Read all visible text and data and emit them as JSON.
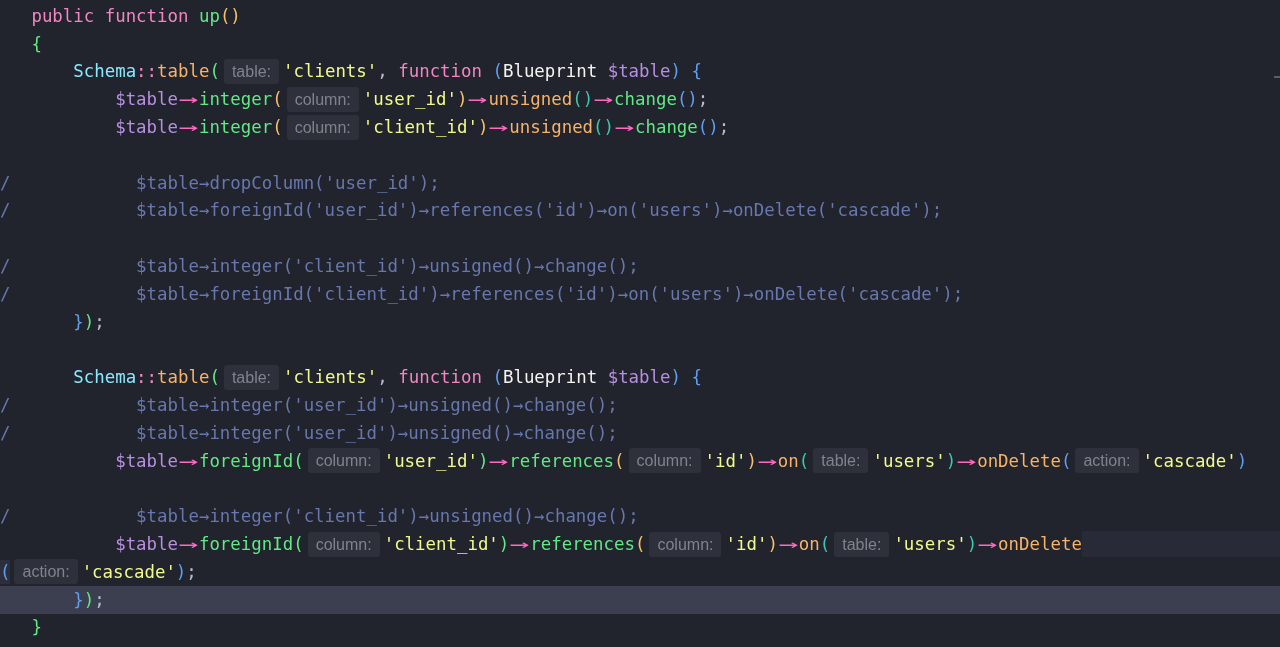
{
  "editor": {
    "lines": [
      {
        "current": false,
        "tokens": [
          {
            "kind": "kw",
            "text": "   public function "
          },
          {
            "kind": "fn",
            "text": "up"
          },
          {
            "kind": "b1",
            "text": "()"
          }
        ]
      },
      {
        "current": false,
        "tokens": [
          {
            "kind": "b4",
            "text": "   {"
          }
        ]
      },
      {
        "current": false,
        "tokens": [
          {
            "kind": "cls",
            "text": "       Schema"
          },
          {
            "kind": "kw",
            "text": "::"
          },
          {
            "kind": "fn2",
            "text": "table"
          },
          {
            "kind": "b4",
            "text": "("
          },
          {
            "kind": "hint",
            "text": "table:"
          },
          {
            "kind": "str",
            "text": "'clients'"
          },
          {
            "kind": "punc",
            "text": ", "
          },
          {
            "kind": "kw",
            "text": "function "
          },
          {
            "kind": "b3",
            "text": "("
          },
          {
            "kind": "plain",
            "text": "Blueprint "
          },
          {
            "kind": "var",
            "text": "$table"
          },
          {
            "kind": "b3",
            "text": ")"
          },
          {
            "kind": "b3",
            "text": " {"
          }
        ]
      },
      {
        "current": false,
        "tokens": [
          {
            "kind": "var",
            "text": "           $table"
          },
          {
            "kind": "arrow",
            "text": "→"
          },
          {
            "kind": "fn",
            "text": "integer"
          },
          {
            "kind": "b1",
            "text": "("
          },
          {
            "kind": "hint",
            "text": "column:"
          },
          {
            "kind": "str",
            "text": "'user_id'"
          },
          {
            "kind": "b1",
            "text": ")"
          },
          {
            "kind": "arrow",
            "text": "→"
          },
          {
            "kind": "fn2",
            "text": "unsigned"
          },
          {
            "kind": "b2",
            "text": "()"
          },
          {
            "kind": "arrow",
            "text": "→"
          },
          {
            "kind": "fn",
            "text": "change"
          },
          {
            "kind": "b3",
            "text": "()"
          },
          {
            "kind": "punc",
            "text": ";"
          }
        ]
      },
      {
        "current": false,
        "tokens": [
          {
            "kind": "var",
            "text": "           $table"
          },
          {
            "kind": "arrow",
            "text": "→"
          },
          {
            "kind": "fn",
            "text": "integer"
          },
          {
            "kind": "b1",
            "text": "("
          },
          {
            "kind": "hint",
            "text": "column:"
          },
          {
            "kind": "str",
            "text": "'client_id'"
          },
          {
            "kind": "b1",
            "text": ")"
          },
          {
            "kind": "arrow",
            "text": "→"
          },
          {
            "kind": "fn2",
            "text": "unsigned"
          },
          {
            "kind": "b2",
            "text": "()"
          },
          {
            "kind": "arrow",
            "text": "→"
          },
          {
            "kind": "fn",
            "text": "change"
          },
          {
            "kind": "b3",
            "text": "()"
          },
          {
            "kind": "punc",
            "text": ";"
          }
        ]
      },
      {
        "current": false
      },
      {
        "current": false,
        "tokens": [
          {
            "kind": "comment",
            "text": "/            $table→dropColumn('user_id');"
          }
        ]
      },
      {
        "current": false,
        "tokens": [
          {
            "kind": "comment",
            "text": "/            $table→foreignId('user_id')→references('id')→on('users')→onDelete('cascade');"
          }
        ]
      },
      {
        "current": false
      },
      {
        "current": false,
        "tokens": [
          {
            "kind": "comment",
            "text": "/            $table→integer('client_id')→unsigned()→change();"
          }
        ]
      },
      {
        "current": false,
        "tokens": [
          {
            "kind": "comment",
            "text": "/            $table→foreignId('client_id')→references('id')→on('users')→onDelete('cascade');"
          }
        ]
      },
      {
        "current": false,
        "tokens": [
          {
            "kind": "b3",
            "text": "       }"
          },
          {
            "kind": "b4",
            "text": ")"
          },
          {
            "kind": "punc",
            "text": ";"
          }
        ]
      },
      {
        "current": false
      },
      {
        "current": false,
        "tokens": [
          {
            "kind": "cls",
            "text": "       Schema"
          },
          {
            "kind": "kw",
            "text": "::"
          },
          {
            "kind": "fn2",
            "text": "table"
          },
          {
            "kind": "b4",
            "text": "("
          },
          {
            "kind": "hint",
            "text": "table:"
          },
          {
            "kind": "str",
            "text": "'clients'"
          },
          {
            "kind": "punc",
            "text": ", "
          },
          {
            "kind": "kw",
            "text": "function "
          },
          {
            "kind": "b3",
            "text": "("
          },
          {
            "kind": "plain",
            "text": "Blueprint "
          },
          {
            "kind": "var",
            "text": "$table"
          },
          {
            "kind": "b3",
            "text": ")"
          },
          {
            "kind": "b3",
            "text": " {"
          }
        ]
      },
      {
        "current": false,
        "tokens": [
          {
            "kind": "comment",
            "text": "/            $table→integer('user_id')→unsigned()→change();"
          }
        ]
      },
      {
        "current": false,
        "tokens": [
          {
            "kind": "comment",
            "text": "/            $table→integer('user_id')→unsigned()→change();"
          }
        ]
      },
      {
        "current": false,
        "tokens": [
          {
            "kind": "var",
            "text": "           $table"
          },
          {
            "kind": "arrow",
            "text": "→"
          },
          {
            "kind": "fn",
            "text": "foreignId"
          },
          {
            "kind": "b4",
            "text": "("
          },
          {
            "kind": "hint",
            "text": "column:"
          },
          {
            "kind": "str",
            "text": "'user_id'"
          },
          {
            "kind": "b4",
            "text": ")"
          },
          {
            "kind": "arrow",
            "text": "→"
          },
          {
            "kind": "fn",
            "text": "references"
          },
          {
            "kind": "b1",
            "text": "("
          },
          {
            "kind": "hint",
            "text": "column:"
          },
          {
            "kind": "str",
            "text": "'id'"
          },
          {
            "kind": "b1",
            "text": ")"
          },
          {
            "kind": "arrow",
            "text": "→"
          },
          {
            "kind": "fn2",
            "text": "on"
          },
          {
            "kind": "b2",
            "text": "("
          },
          {
            "kind": "hint",
            "text": "table:"
          },
          {
            "kind": "str",
            "text": "'users'"
          },
          {
            "kind": "b2",
            "text": ")"
          },
          {
            "kind": "arrow",
            "text": "→"
          },
          {
            "kind": "fn2",
            "text": "onDelete"
          },
          {
            "kind": "b3",
            "text": "("
          },
          {
            "kind": "hint",
            "text": "action:"
          },
          {
            "kind": "str",
            "text": "'cascade'"
          },
          {
            "kind": "b3",
            "text": ")"
          }
        ]
      },
      {
        "current": false
      },
      {
        "current": false,
        "tokens": [
          {
            "kind": "comment",
            "text": "/            $table→integer('client_id')→unsigned()→change();"
          }
        ]
      },
      {
        "current": false,
        "wrap_tail": true,
        "tokens": [
          {
            "kind": "var",
            "text": "           $table"
          },
          {
            "kind": "arrow",
            "text": "→"
          },
          {
            "kind": "fn",
            "text": "foreignId"
          },
          {
            "kind": "b4",
            "text": "("
          },
          {
            "kind": "hint",
            "text": "column:"
          },
          {
            "kind": "str",
            "text": "'client_id'"
          },
          {
            "kind": "b4",
            "text": ")"
          },
          {
            "kind": "arrow",
            "text": "→"
          },
          {
            "kind": "fn",
            "text": "references"
          },
          {
            "kind": "b1",
            "text": "("
          },
          {
            "kind": "hint",
            "text": "column:"
          },
          {
            "kind": "str",
            "text": "'id'"
          },
          {
            "kind": "b1",
            "text": ")"
          },
          {
            "kind": "arrow",
            "text": "→"
          },
          {
            "kind": "fn2",
            "text": "on"
          },
          {
            "kind": "b2",
            "text": "("
          },
          {
            "kind": "hint",
            "text": "table:"
          },
          {
            "kind": "str",
            "text": "'users'"
          },
          {
            "kind": "b2",
            "text": ")"
          },
          {
            "kind": "arrow",
            "text": "→"
          },
          {
            "kind": "fn2",
            "text": "onDelete"
          }
        ]
      },
      {
        "current": false,
        "wrap_head": true,
        "tokens": [
          {
            "kind": "b3",
            "text": "("
          },
          {
            "kind": "hint",
            "text": "action:"
          },
          {
            "kind": "str",
            "text": "'cascade'"
          },
          {
            "kind": "b3",
            "text": ")"
          },
          {
            "kind": "punc",
            "text": ";"
          }
        ]
      },
      {
        "current": true,
        "tokens": [
          {
            "kind": "b3",
            "text": "       }"
          },
          {
            "kind": "b4",
            "text": ")"
          },
          {
            "kind": "punc",
            "text": ";"
          }
        ]
      },
      {
        "current": false,
        "tokens": [
          {
            "kind": "b4",
            "text": "   }"
          }
        ]
      }
    ]
  }
}
